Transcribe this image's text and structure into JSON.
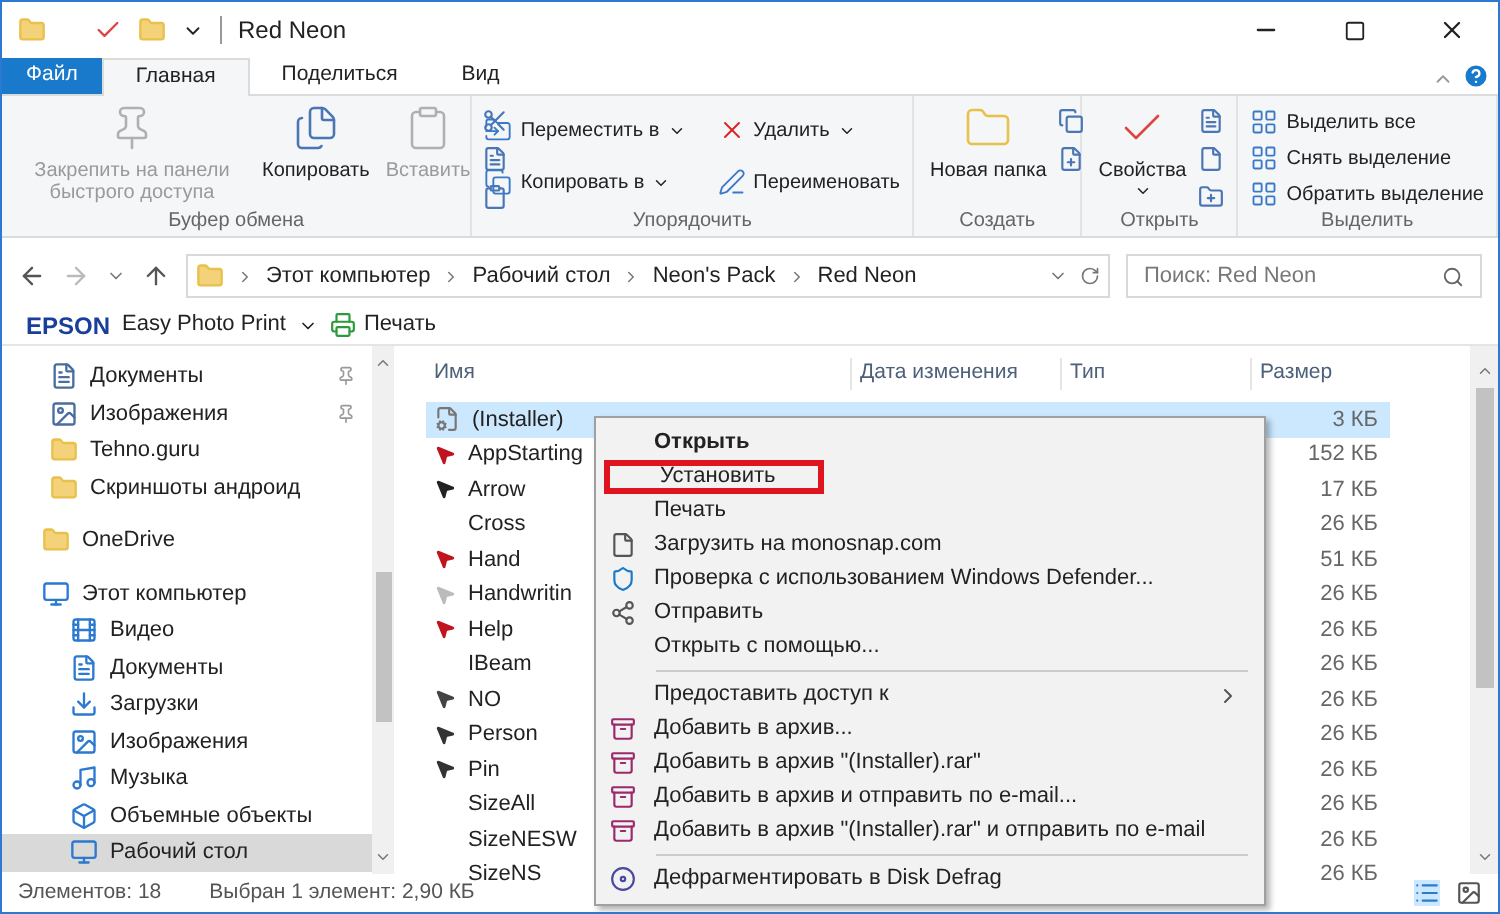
{
  "window": {
    "title": "Red Neon"
  },
  "ribbon_tabs": [
    {
      "label": "Файл",
      "kind": "file",
      "selected": false
    },
    {
      "label": "Главная",
      "kind": "tab",
      "selected": true
    },
    {
      "label": "Поделиться",
      "kind": "tab",
      "selected": false
    },
    {
      "label": "Вид",
      "kind": "tab",
      "selected": false
    }
  ],
  "ribbon_groups": [
    {
      "label": "Буфер обмена",
      "buttons": [
        {
          "label": "Закрепить на панели быстрого доступа",
          "kind": "large",
          "disabled": true,
          "dropdown": false
        },
        {
          "label": "Копировать",
          "kind": "large",
          "disabled": false,
          "dropdown": false
        },
        {
          "label": "Вставить",
          "kind": "large",
          "disabled": true,
          "dropdown": false
        }
      ]
    },
    {
      "label": "Упорядочить",
      "buttons": [
        {
          "label": "Переместить в",
          "kind": "small",
          "disabled": false,
          "dropdown": true
        },
        {
          "label": "Копировать в",
          "kind": "small",
          "disabled": false,
          "dropdown": true
        },
        {
          "label": "Удалить",
          "kind": "small",
          "disabled": false,
          "dropdown": true
        },
        {
          "label": "Переименовать",
          "kind": "small",
          "disabled": false,
          "dropdown": false
        }
      ]
    },
    {
      "label": "Создать",
      "buttons": [
        {
          "label": "Новая папка",
          "kind": "large",
          "disabled": false,
          "dropdown": false
        }
      ]
    },
    {
      "label": "Открыть",
      "buttons": [
        {
          "label": "Свойства",
          "kind": "large",
          "disabled": false,
          "dropdown": true
        }
      ]
    },
    {
      "label": "Выделить",
      "buttons": [
        {
          "label": "Выделить все",
          "kind": "small",
          "disabled": false,
          "dropdown": false
        },
        {
          "label": "Снять выделение",
          "kind": "small",
          "disabled": false,
          "dropdown": false
        },
        {
          "label": "Обратить выделение",
          "kind": "small",
          "disabled": false,
          "dropdown": false
        }
      ]
    }
  ],
  "address": {
    "path": [
      "Этот компьютер",
      "Рабочий стол",
      "Neon's Pack",
      "Red Neon"
    ]
  },
  "search": {
    "placeholder": "Поиск: Red Neon"
  },
  "toolbar": {
    "brand": "EPSON",
    "app": "Easy Photo Print",
    "print": "Печать"
  },
  "sidebar": {
    "quick_access": [
      {
        "label": "Документы",
        "pinned": true,
        "selected": false
      },
      {
        "label": "Изображения",
        "pinned": true,
        "selected": false
      },
      {
        "label": "Tehno.guru",
        "pinned": false,
        "selected": false
      },
      {
        "label": "Скриншоты андроид",
        "pinned": false,
        "selected": false
      }
    ],
    "tree": [
      {
        "label": "OneDrive",
        "selected": false
      },
      {
        "label": "Этот компьютер",
        "selected": false,
        "children": [
          {
            "label": "Видео",
            "selected": false
          },
          {
            "label": "Документы",
            "selected": false
          },
          {
            "label": "Загрузки",
            "selected": false
          },
          {
            "label": "Изображения",
            "selected": false
          },
          {
            "label": "Музыка",
            "selected": false
          },
          {
            "label": "Объемные объекты",
            "selected": false
          },
          {
            "label": "Рабочий стол",
            "selected": true
          }
        ]
      }
    ]
  },
  "table": {
    "columns": [
      "Имя",
      "Дата изменения",
      "Тип",
      "Размер"
    ],
    "rows": [
      {
        "name": "(Installer)",
        "size": "3 КБ",
        "selected": true
      },
      {
        "name": "AppStarting",
        "size": "152 КБ",
        "selected": false
      },
      {
        "name": "Arrow",
        "size": "17 КБ",
        "selected": false
      },
      {
        "name": "Cross",
        "size": "26 КБ",
        "selected": false
      },
      {
        "name": "Hand",
        "size": "51 КБ",
        "selected": false
      },
      {
        "name": "Handwritin",
        "size": "26 КБ",
        "selected": false
      },
      {
        "name": "Help",
        "size": "26 КБ",
        "selected": false
      },
      {
        "name": "IBeam",
        "size": "26 КБ",
        "selected": false
      },
      {
        "name": "NO",
        "size": "26 КБ",
        "selected": false
      },
      {
        "name": "Person",
        "size": "26 КБ",
        "selected": false
      },
      {
        "name": "Pin",
        "size": "26 КБ",
        "selected": false
      },
      {
        "name": "SizeAll",
        "size": "26 КБ",
        "selected": false
      },
      {
        "name": "SizeNESW",
        "size": "26 КБ",
        "selected": false
      },
      {
        "name": "SizeNS",
        "size": "26 КБ",
        "selected": false
      }
    ]
  },
  "context_menu": {
    "items": [
      {
        "kind": "item",
        "label": "Открыть",
        "default": true,
        "highlighted": false,
        "submenu": false
      },
      {
        "kind": "item",
        "label": "Установить",
        "default": false,
        "highlighted": true,
        "submenu": false
      },
      {
        "kind": "item",
        "label": "Печать",
        "default": false,
        "highlighted": false,
        "submenu": false
      },
      {
        "kind": "item",
        "label": "Загрузить на monosnap.com",
        "default": false,
        "highlighted": false,
        "submenu": false
      },
      {
        "kind": "item",
        "label": "Проверка с использованием Windows Defender...",
        "default": false,
        "highlighted": false,
        "submenu": false
      },
      {
        "kind": "item",
        "label": "Отправить",
        "default": false,
        "highlighted": false,
        "submenu": false
      },
      {
        "kind": "item",
        "label": "Открыть с помощью...",
        "default": false,
        "highlighted": false,
        "submenu": false
      },
      {
        "kind": "separator"
      },
      {
        "kind": "item",
        "label": "Предоставить доступ к",
        "default": false,
        "highlighted": false,
        "submenu": true
      },
      {
        "kind": "item",
        "label": "Добавить в архив...",
        "default": false,
        "highlighted": false,
        "submenu": false
      },
      {
        "kind": "item",
        "label": "Добавить в архив \"(Installer).rar\"",
        "default": false,
        "highlighted": false,
        "submenu": false
      },
      {
        "kind": "item",
        "label": "Добавить в архив и отправить по e-mail...",
        "default": false,
        "highlighted": false,
        "submenu": false
      },
      {
        "kind": "item",
        "label": "Добавить в архив \"(Installer).rar\" и отправить по e-mail",
        "default": false,
        "highlighted": false,
        "submenu": false
      },
      {
        "kind": "separator"
      },
      {
        "kind": "item",
        "label": "Дефрагментировать в Disk Defrag",
        "default": false,
        "highlighted": false,
        "submenu": false
      }
    ]
  },
  "status_bar": {
    "count": "Элементов: 18",
    "selection": "Выбран 1 элемент: 2,90 КБ"
  }
}
